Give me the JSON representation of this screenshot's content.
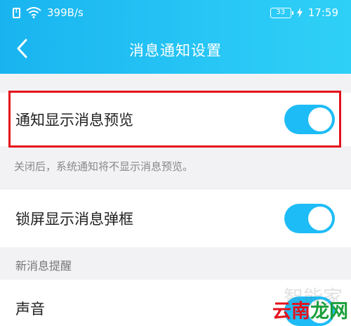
{
  "status_bar": {
    "network_speed": "399B/s",
    "battery_level": "33",
    "time": "17:59"
  },
  "header": {
    "title": "消息通知设置"
  },
  "settings": {
    "preview": {
      "label": "通知显示消息预览",
      "enabled": true,
      "note": "关闭后，系统通知将不显示消息预览。"
    },
    "lockscreen_popup": {
      "label": "锁屏显示消息弹框",
      "enabled": true
    },
    "new_message_section": "新消息提醒",
    "sound": {
      "label": "声音",
      "enabled": true
    }
  },
  "watermark": {
    "faint_text": "智能家",
    "part1": "云南",
    "part2": "龙网"
  },
  "colors": {
    "header_gradient_start": "#19b4f0",
    "header_gradient_end": "#2fd0f7",
    "toggle_on": "#1ebcf6",
    "highlight_border": "#e4121b",
    "page_background": "#f2f2f5"
  }
}
